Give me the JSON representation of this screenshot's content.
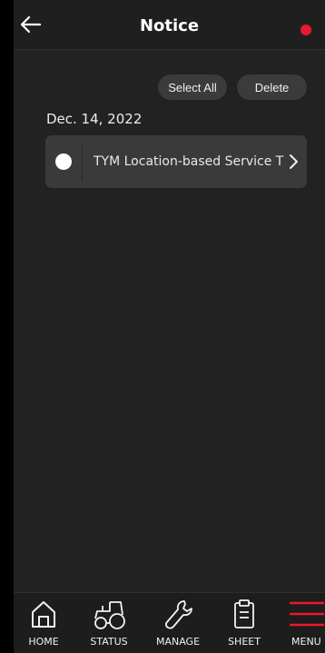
{
  "header": {
    "title": "Notice",
    "back_icon": "arrow-left-icon",
    "status_color": "#e8192c"
  },
  "actions": {
    "select_all_label": "Select All",
    "delete_label": "Delete"
  },
  "notices": [
    {
      "date": "Dec. 14, 2022",
      "title": "TYM Location-based Service T",
      "selected": false
    }
  ],
  "bottom_nav": [
    {
      "label": "HOME",
      "icon": "home-icon"
    },
    {
      "label": "STATUS",
      "icon": "tractor-icon"
    },
    {
      "label": "MANAGE",
      "icon": "wrench-icon"
    },
    {
      "label": "SHEET",
      "icon": "clipboard-icon"
    },
    {
      "label": "MENU",
      "icon": "menu-icon"
    }
  ],
  "colors": {
    "accent": "#e8192c",
    "background": "#222222",
    "card": "#3a3a3a"
  }
}
